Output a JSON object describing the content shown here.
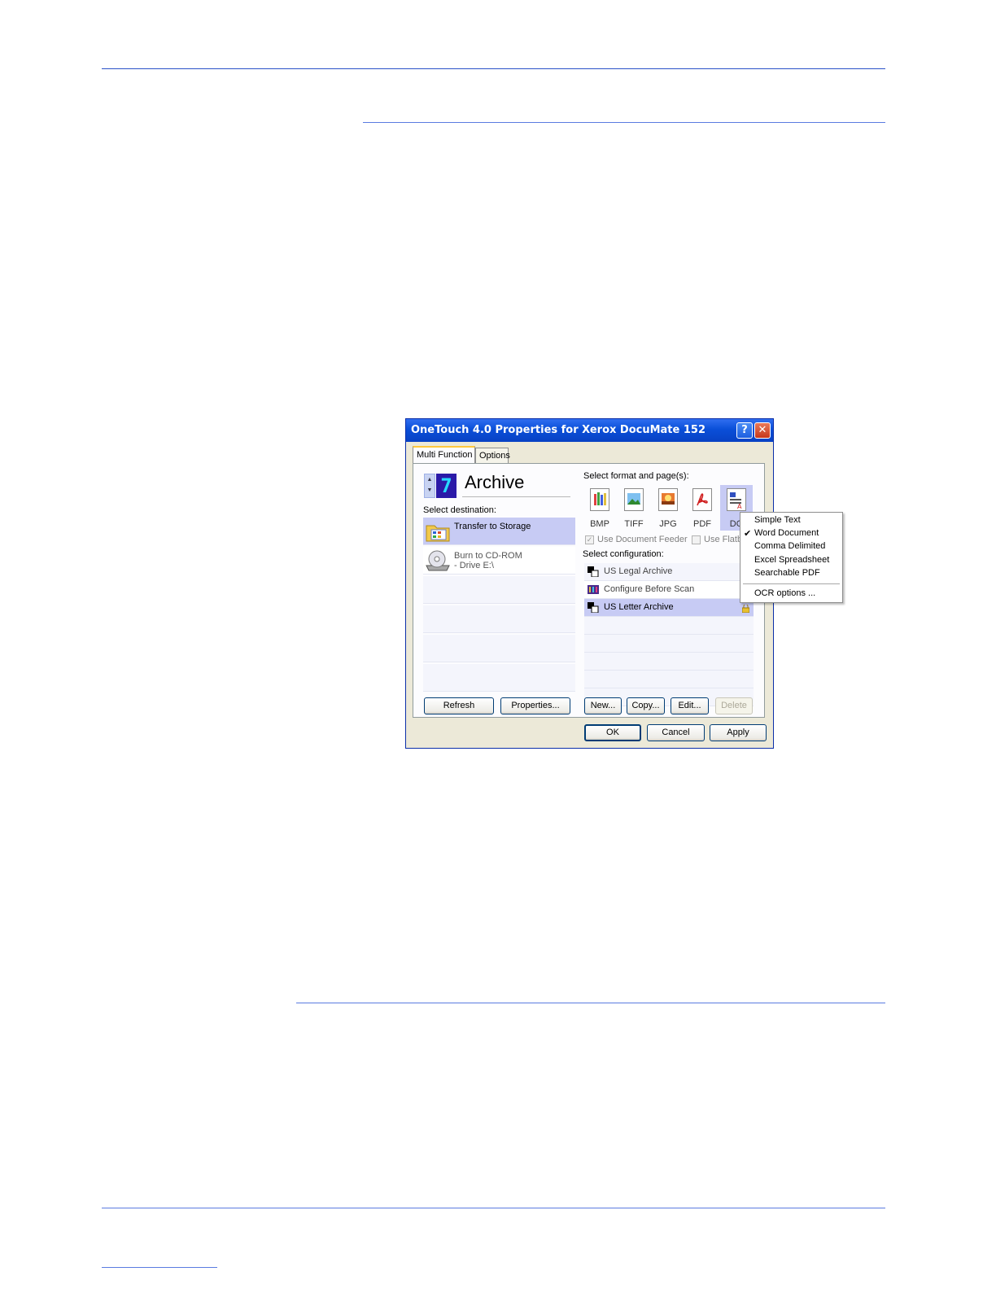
{
  "window": {
    "title": "OneTouch 4.0 Properties for Xerox DocuMate 152",
    "help_glyph": "?",
    "close_glyph": "✕",
    "tabs": [
      {
        "label": "Multi Function",
        "active": true
      },
      {
        "label": "Options",
        "active": false
      }
    ]
  },
  "button_selector": {
    "number": "7",
    "up_glyph": "▲",
    "down_glyph": "▼",
    "name": "Archive"
  },
  "destination": {
    "label": "Select destination:",
    "items": [
      {
        "line1": "Transfer to Storage",
        "line2": "",
        "selected": true,
        "icon": "folder-icon"
      },
      {
        "line1": "Burn to CD-ROM",
        "line2": "- Drive E:\\",
        "selected": false,
        "icon": "cd-drive-icon"
      }
    ]
  },
  "format": {
    "label": "Select format and page(s):",
    "items": [
      {
        "label": "BMP",
        "icon": "bmp-icon"
      },
      {
        "label": "TIFF",
        "icon": "tiff-icon"
      },
      {
        "label": "JPG",
        "icon": "jpg-icon"
      },
      {
        "label": "PDF",
        "icon": "pdf-icon"
      },
      {
        "label": "DO",
        "icon": "doc-icon",
        "selected": true
      }
    ],
    "use_document_feeder": "Use Document Feeder",
    "use_flatbed": "Use Flatb"
  },
  "configuration": {
    "label": "Select configuration:",
    "items": [
      {
        "label": "US Legal Archive",
        "selected": false
      },
      {
        "label": "Configure Before Scan",
        "selected": false
      },
      {
        "label": "US Letter Archive",
        "selected": true
      }
    ]
  },
  "buttons": {
    "refresh": "Refresh",
    "properties": "Properties...",
    "new": "New...",
    "copy": "Copy...",
    "edit": "Edit...",
    "delete": "Delete",
    "ok": "OK",
    "cancel": "Cancel",
    "apply": "Apply"
  },
  "context_menu": {
    "items": [
      {
        "label": "Simple Text",
        "checked": false
      },
      {
        "label": "Word Document",
        "checked": true
      },
      {
        "label": "Comma Delimited",
        "checked": false
      },
      {
        "label": "Excel Spreadsheet",
        "checked": false
      },
      {
        "label": "Searchable PDF",
        "checked": false
      }
    ],
    "check_glyph": "✔",
    "ocr_options": "OCR options ..."
  },
  "colors": {
    "rule": "#2a52c8",
    "titlebar": "#0a4fd8",
    "selection": "#c7cbf4"
  }
}
